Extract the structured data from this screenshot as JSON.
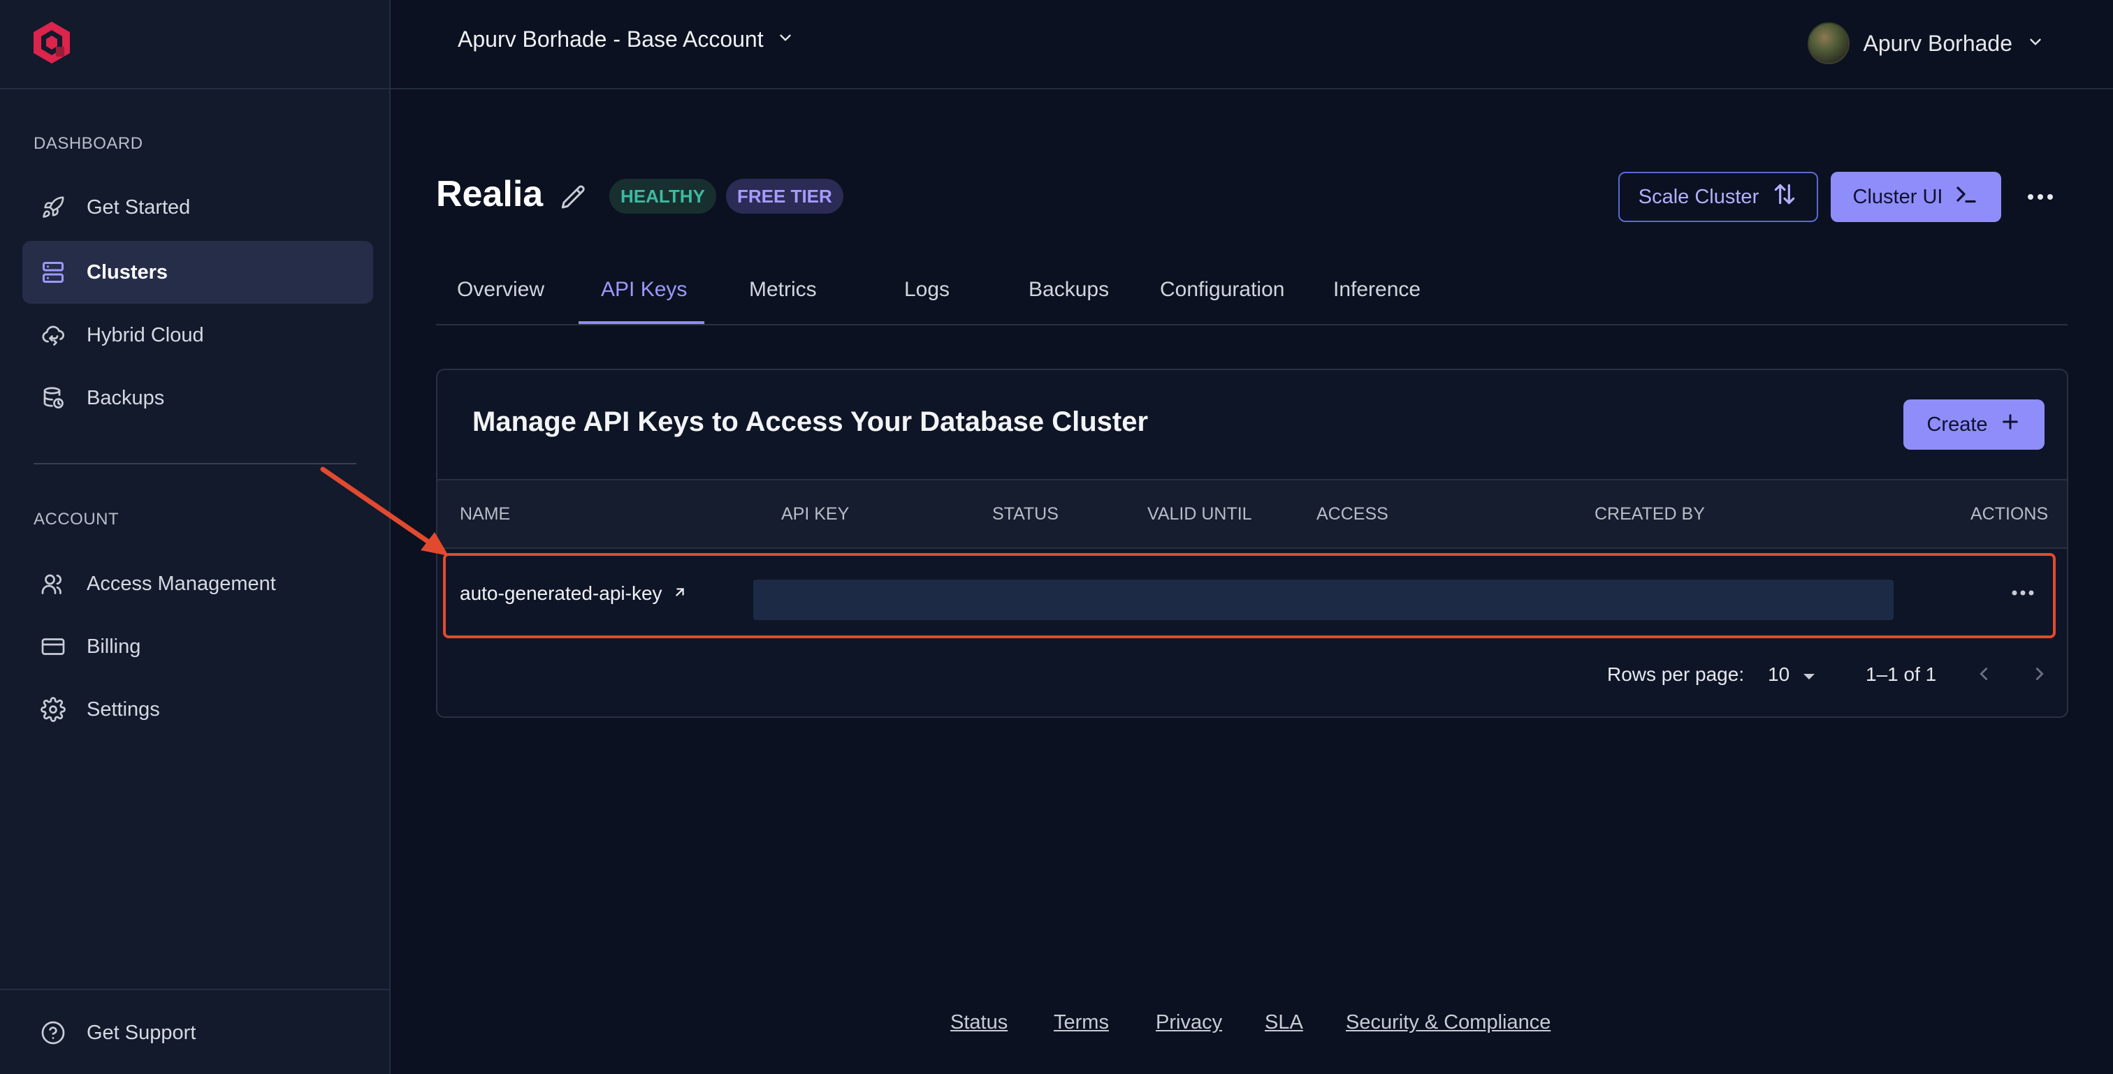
{
  "sidebar": {
    "logo_icon": "qdrant-logo-icon",
    "sections": {
      "dashboard": "DASHBOARD",
      "account": "ACCOUNT"
    },
    "items": [
      {
        "label": "Get Started",
        "icon": "rocket-icon"
      },
      {
        "label": "Clusters",
        "icon": "server-icon",
        "active": true
      },
      {
        "label": "Hybrid Cloud",
        "icon": "cloud-sync-icon"
      },
      {
        "label": "Backups",
        "icon": "database-backup-icon"
      },
      {
        "label": "Access Management",
        "icon": "users-icon"
      },
      {
        "label": "Billing",
        "icon": "credit-card-icon"
      },
      {
        "label": "Settings",
        "icon": "gear-icon"
      }
    ],
    "support": {
      "label": "Get Support",
      "icon": "help-circle-icon"
    }
  },
  "header": {
    "account": "Apurv Borhade - Base Account",
    "user": "Apurv Borhade"
  },
  "cluster": {
    "name": "Realia",
    "badges": {
      "health": "HEALTHY",
      "tier": "FREE TIER"
    },
    "scale_button": "Scale Cluster",
    "ui_button": "Cluster UI"
  },
  "tabs": [
    "Overview",
    "API Keys",
    "Metrics",
    "Logs",
    "Backups",
    "Configuration",
    "Inference"
  ],
  "active_tab": "API Keys",
  "api_keys": {
    "title": "Manage API Keys to Access Your Database Cluster",
    "create_button": "Create",
    "columns": [
      "NAME",
      "API KEY",
      "STATUS",
      "VALID UNTIL",
      "ACCESS",
      "CREATED BY",
      "ACTIONS"
    ],
    "rows": [
      {
        "name": "auto-generated-api-key",
        "api_key": "",
        "status": "",
        "valid_until": "",
        "access": "",
        "created_by": ""
      }
    ],
    "pagination": {
      "rows_per_page_label": "Rows per page:",
      "rows_per_page": "10",
      "range": "1–1 of 1"
    }
  },
  "footer": [
    "Status",
    "Terms",
    "Privacy",
    "SLA",
    "Security & Compliance"
  ],
  "colors": {
    "accent": "#8f8dfa",
    "healthy": "#3fb9a0",
    "highlight": "#e24a2f",
    "background": "#0b1120"
  }
}
